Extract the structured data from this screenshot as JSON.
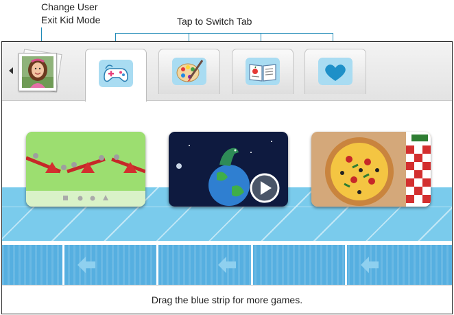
{
  "callouts": {
    "change_user": "Change User",
    "exit_kid_mode": "Exit Kid Mode",
    "switch_tab": "Tap to Switch Tab"
  },
  "profile": {
    "icon": "user-photo-avatar"
  },
  "tabs": [
    {
      "icon": "gamepad-icon",
      "active": true
    },
    {
      "icon": "palette-icon",
      "active": false
    },
    {
      "icon": "book-icon",
      "active": false
    },
    {
      "icon": "heart-icon",
      "active": false
    }
  ],
  "games": [
    {
      "icon": "seesaw-balance-game"
    },
    {
      "icon": "dinosaur-earth-video"
    },
    {
      "icon": "pizza-game"
    }
  ],
  "strip": {
    "arrow_icon": "left-arrow-icon"
  },
  "footer": {
    "text": "Drag the blue strip for more games."
  },
  "colors": {
    "callout_line": "#1f8ab7",
    "strip": "#74c4e8",
    "strip_dark": "#56afe0",
    "heart": "#1e90c8"
  }
}
